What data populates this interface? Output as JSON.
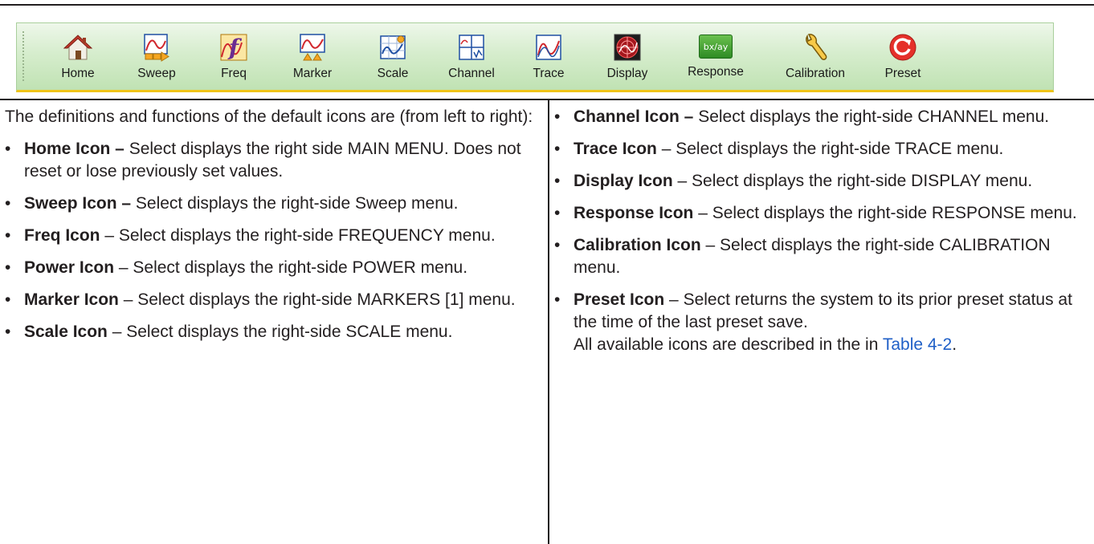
{
  "toolbar": {
    "buttons": [
      {
        "label": "Home",
        "icon": "home-icon"
      },
      {
        "label": "Sweep",
        "icon": "sweep-icon"
      },
      {
        "label": "Freq",
        "icon": "freq-icon"
      },
      {
        "label": "Marker",
        "icon": "marker-icon"
      },
      {
        "label": "Scale",
        "icon": "scale-icon"
      },
      {
        "label": "Channel",
        "icon": "channel-icon"
      },
      {
        "label": "Trace",
        "icon": "trace-icon"
      },
      {
        "label": "Display",
        "icon": "display-icon"
      },
      {
        "label": "Response",
        "icon": "response-icon"
      },
      {
        "label": "Calibration",
        "icon": "calibration-icon"
      },
      {
        "label": "Preset",
        "icon": "preset-icon"
      }
    ],
    "response_badge": "bx/ay",
    "colors": {
      "bar_top": "#eef7ea",
      "bar_bottom": "#c0e2b3",
      "underline": "#f0c419",
      "preset_red": "#e5302a",
      "display_bg": "#a4171d"
    }
  },
  "doc": {
    "intro": "The definitions and functions of the default icons are (from left to right):",
    "left_items": [
      {
        "bullet": "•",
        "title": "Home Icon –",
        "desc": " Select displays the right side MAIN MENU. Does not reset or lose previously set values."
      },
      {
        "bullet": "•",
        "title": "Sweep Icon –",
        "desc": " Select displays the right-side Sweep menu."
      },
      {
        "bullet": "•",
        "title": "Freq Icon",
        "desc": " – Select displays the right-side FREQUENCY menu."
      },
      {
        "bullet": "•",
        "title": "Power Icon",
        "desc": " – Select displays the right-side POWER menu."
      },
      {
        "bullet": "•",
        "title": "Marker Icon",
        "desc": " – Select displays the right-side MARKERS [1] menu."
      },
      {
        "bullet": "•",
        "title": "Scale Icon",
        "desc": " – Select displays the right-side SCALE menu."
      }
    ],
    "right_items": [
      {
        "bullet": "•",
        "title": "Channel Icon –",
        "desc": " Select displays the right-side CHANNEL menu."
      },
      {
        "bullet": "•",
        "title": "Trace Icon",
        "desc": " – Select displays the right-side TRACE menu."
      },
      {
        "bullet": "•",
        "title": "Display Icon",
        "desc": " – Select displays the right-side DISPLAY menu."
      },
      {
        "bullet": "•",
        "title": "Response Icon",
        "desc": " – Select displays the right-side RESPONSE menu."
      },
      {
        "bullet": "•",
        "title": "Calibration Icon",
        "desc": " – Select displays the right-side CALIBRATION menu."
      },
      {
        "bullet": "•",
        "title": "Preset Icon",
        "desc": " – Select returns the system to its prior preset status at the time of the last preset save."
      }
    ],
    "closing_text": "All available icons are described in the in ",
    "closing_link": "Table 4-2",
    "closing_end": "."
  }
}
